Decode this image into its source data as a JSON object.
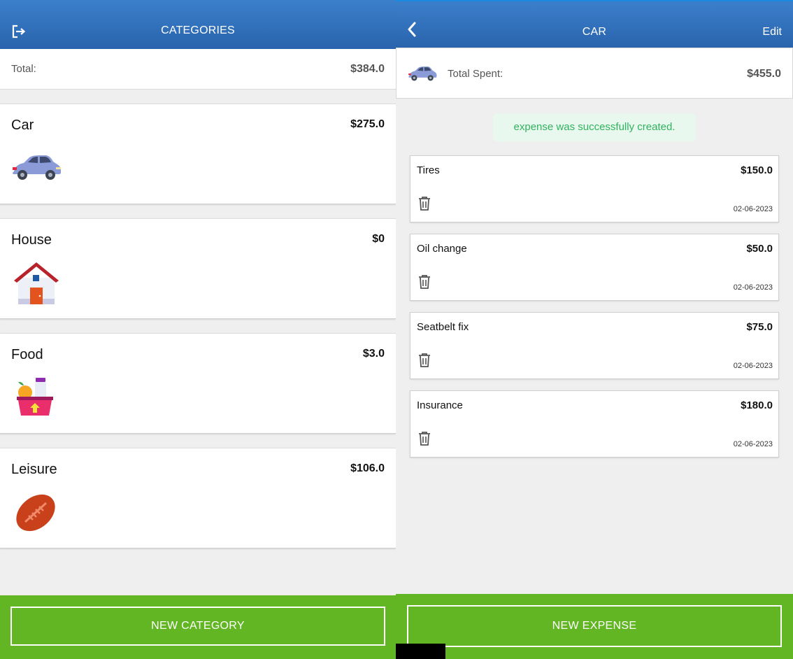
{
  "categories_screen": {
    "title": "CATEGORIES",
    "total": {
      "label": "Total:",
      "amount": "$384.0"
    },
    "categories": [
      {
        "name": "Car",
        "amount": "$275.0",
        "icon": "car-icon"
      },
      {
        "name": "House",
        "amount": "$0",
        "icon": "house-icon"
      },
      {
        "name": "Food",
        "amount": "$3.0",
        "icon": "grocery-basket-icon"
      },
      {
        "name": "Leisure",
        "amount": "$106.0",
        "icon": "football-icon"
      }
    ],
    "new_button": "NEW CATEGORY"
  },
  "detail_screen": {
    "title": "CAR",
    "edit_label": "Edit",
    "total_spent": {
      "label": "Total Spent:",
      "amount": "$455.0"
    },
    "notice": "expense was successfully created.",
    "expenses": [
      {
        "name": "Tires",
        "amount": "$150.0",
        "date": "02-06-2023"
      },
      {
        "name": "Oil change",
        "amount": "$50.0",
        "date": "02-06-2023"
      },
      {
        "name": "Seatbelt fix",
        "amount": "$75.0",
        "date": "02-06-2023"
      },
      {
        "name": "Insurance",
        "amount": "$180.0",
        "date": "02-06-2023"
      }
    ],
    "new_button": "NEW EXPENSE"
  },
  "colors": {
    "header": "#2f6db9",
    "footer": "#62b623",
    "notice_bg": "#e9f8ee",
    "notice_text": "#2fb35f"
  }
}
